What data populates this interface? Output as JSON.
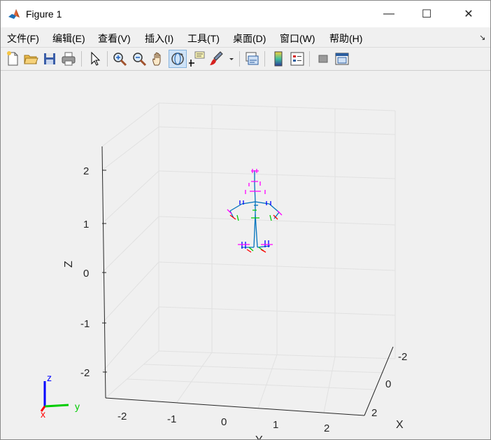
{
  "window": {
    "title": "Figure 1",
    "controls": {
      "minimize": "—",
      "maximize": "☐",
      "close": "✕"
    }
  },
  "menu": {
    "items": [
      "文件(F)",
      "编辑(E)",
      "查看(V)",
      "插入(I)",
      "工具(T)",
      "桌面(D)",
      "窗口(W)",
      "帮助(H)"
    ],
    "overflow_arrow": "↘"
  },
  "toolbar": {
    "buttons": [
      {
        "name": "new-figure-icon"
      },
      {
        "name": "open-file-icon"
      },
      {
        "name": "save-icon"
      },
      {
        "name": "print-icon"
      },
      {
        "name": "select-pointer-icon"
      },
      {
        "name": "zoom-in-icon"
      },
      {
        "name": "zoom-out-icon"
      },
      {
        "name": "pan-hand-icon"
      },
      {
        "name": "rotate-3d-icon",
        "active": true
      },
      {
        "name": "data-cursor-icon"
      },
      {
        "name": "brush-icon"
      },
      {
        "name": "link-plot-icon"
      },
      {
        "name": "colorbar-icon"
      },
      {
        "name": "legend-icon"
      },
      {
        "name": "hide-plot-tools-icon"
      },
      {
        "name": "show-plot-tools-icon"
      }
    ]
  },
  "plot": {
    "z_axis": {
      "label": "Z",
      "ticks": [
        "2",
        "1",
        "0",
        "-1",
        "-2"
      ]
    },
    "y_axis": {
      "label": "Y",
      "ticks": [
        "-2",
        "-1",
        "0",
        "1",
        "2"
      ]
    },
    "x_axis": {
      "label": "X",
      "ticks": [
        "-2",
        "0",
        "2"
      ]
    },
    "orientation_triad": {
      "z": "z",
      "y": "y",
      "x": "x"
    },
    "colors": {
      "skeleton": "#0072bd",
      "frame_x": "#ff0000",
      "frame_y": "#00cc00",
      "frame_z": "#ff00ff",
      "frame_blue": "#0000ff"
    }
  }
}
